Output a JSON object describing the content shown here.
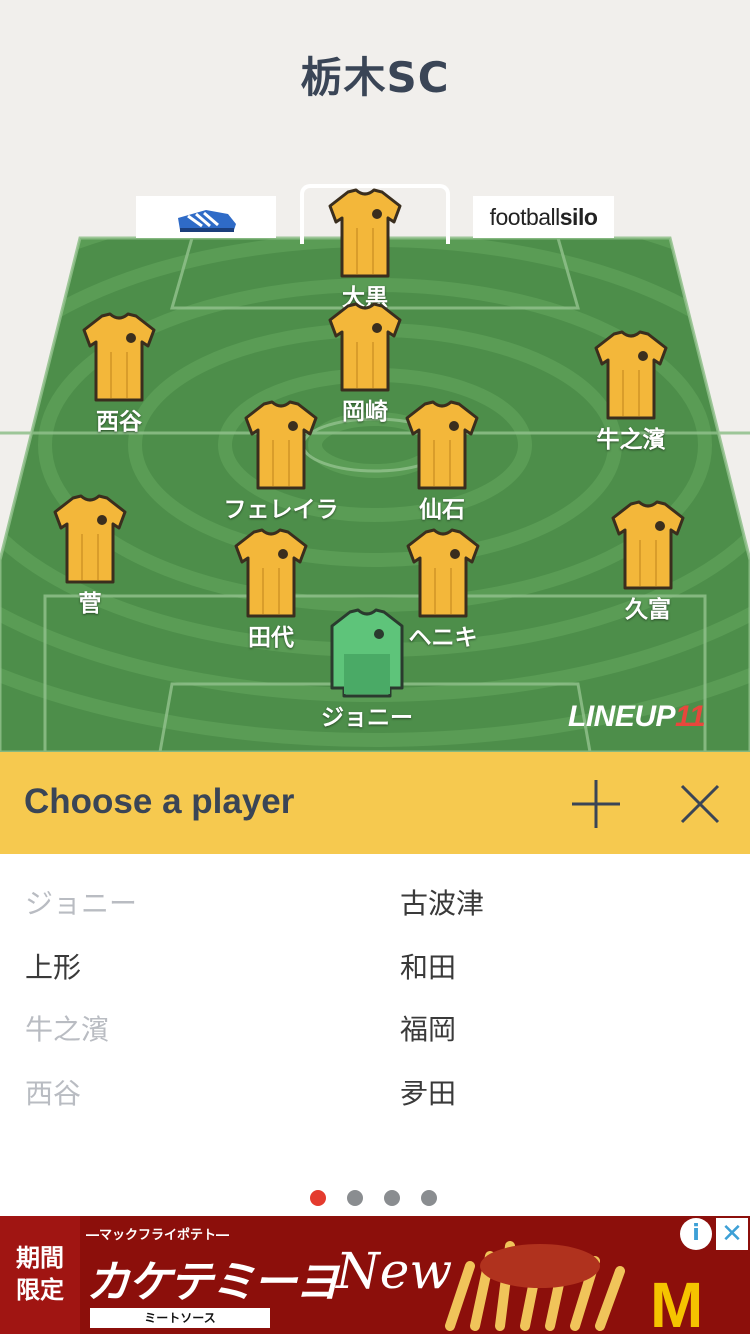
{
  "team": {
    "title": "栃木SC"
  },
  "sponsors": {
    "right_brand_regular": "football",
    "right_brand_bold": "silo"
  },
  "watermark": {
    "text": "LINEUP",
    "number": "11"
  },
  "players": [
    {
      "name": "大黒",
      "kit": "outfield"
    },
    {
      "name": "西谷",
      "kit": "outfield"
    },
    {
      "name": "岡崎",
      "kit": "outfield"
    },
    {
      "name": "牛之濱",
      "kit": "outfield"
    },
    {
      "name": "フェレイラ",
      "kit": "outfield"
    },
    {
      "name": "仙石",
      "kit": "outfield"
    },
    {
      "name": "菅",
      "kit": "outfield"
    },
    {
      "name": "田代",
      "kit": "outfield"
    },
    {
      "name": "ヘニキ",
      "kit": "outfield"
    },
    {
      "name": "久富",
      "kit": "outfield"
    },
    {
      "name": "ジョニー",
      "kit": "goalkeeper"
    }
  ],
  "chooser": {
    "title": "Choose a player",
    "add_icon": "plus-icon",
    "close_icon": "close-icon",
    "left_column": [
      {
        "name": "ジョニー",
        "used": true
      },
      {
        "name": "上形",
        "used": false
      },
      {
        "name": "牛之濱",
        "used": true
      },
      {
        "name": "西谷",
        "used": true
      }
    ],
    "right_column": [
      {
        "name": "古波津",
        "used": false
      },
      {
        "name": "和田",
        "used": false
      },
      {
        "name": "福岡",
        "used": false
      },
      {
        "name": "夛田",
        "used": false
      }
    ]
  },
  "pager": {
    "pages": 4,
    "active": 0
  },
  "ad": {
    "limited_label": "期間限定",
    "subtitle": "―マックフライポテト―",
    "headline": "カケテミーヨ",
    "product": "ミートソース",
    "new_label": "New",
    "logo": "M",
    "info_icon": "info-icon",
    "close_icon": "ad-close-icon"
  },
  "colors": {
    "background": "#f1efec",
    "pitch_dark": "#4d8e4a",
    "pitch_light": "#5a9c55",
    "home_kit": "#f3b73a",
    "keeper_kit": "#5ec47a",
    "accent_bar": "#f6c94f",
    "title_text": "#3a4556"
  }
}
